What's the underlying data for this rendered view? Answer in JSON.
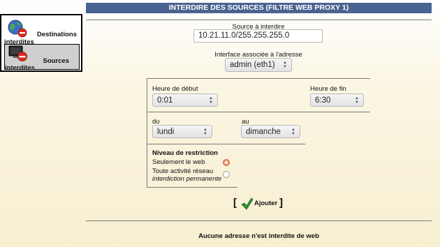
{
  "header": {
    "title": "INTERDIRE DES SOURCES (FILTRE WEB PROXY 1)"
  },
  "sidebar": {
    "items": [
      {
        "line1": "Destinations",
        "line2": "interdites",
        "icon": "globe-forbidden-icon",
        "active": false
      },
      {
        "line1": "Sources",
        "line2": "interdites",
        "icon": "monitor-forbidden-icon",
        "active": true
      }
    ]
  },
  "form": {
    "source_label": "Source à interdire",
    "source_value": "10.21.11.0/255.255.255.0",
    "interface_label": "Interface associée à l'adresse",
    "interface_value": "admin (eth1)",
    "start_label": "Heure de début",
    "start_value": "0:01",
    "end_label": "Heure de fin",
    "end_value": "6:30",
    "from_label": "du",
    "from_value": "lundi",
    "to_label": "au",
    "to_value": "dimanche",
    "restriction_title": "Niveau de restriction",
    "option_web": "Seulement le web",
    "option_all_line1": "Toute activité réseau",
    "option_all_line2": "interdiction permanente",
    "selected_option": "Seulement le web",
    "add_label": "Ajouter"
  },
  "status": {
    "message": "Aucune adresse n'est interdite de web"
  },
  "colors": {
    "title_bar": "#4a6390",
    "radio_selected": "#f1946d",
    "check_green": "#2e9a2e",
    "forbidden_red": "#d9281e"
  }
}
